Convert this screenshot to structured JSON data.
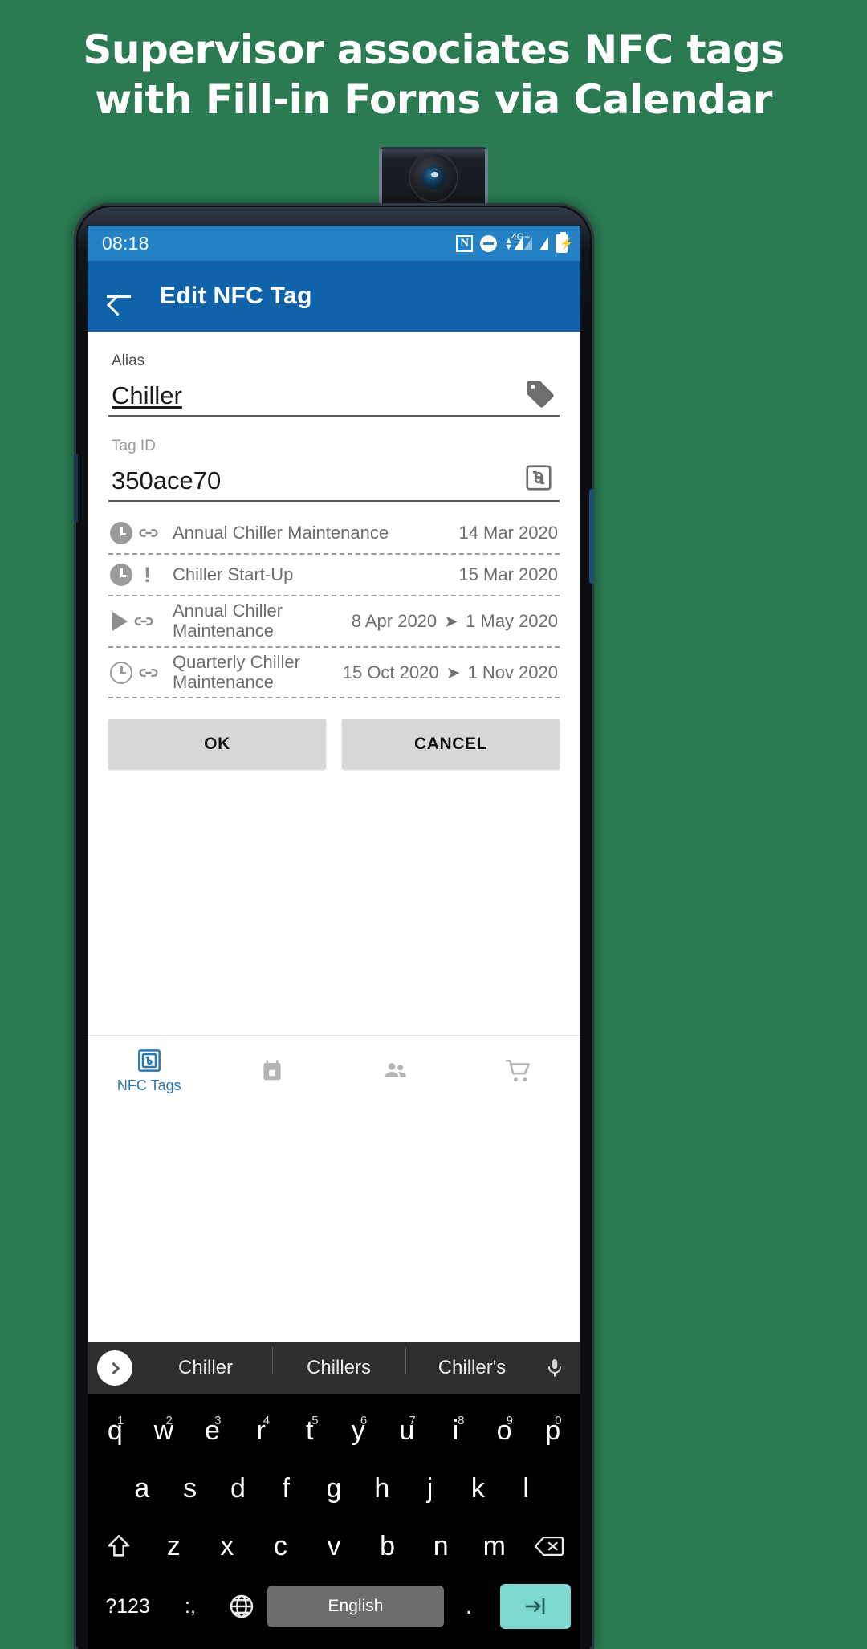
{
  "headline": {
    "line1": "Supervisor associates NFC tags",
    "line2": "with Fill-in Forms via Calendar"
  },
  "status_bar": {
    "time": "08:18",
    "icons": [
      "nfc-icon",
      "do-not-disturb-icon",
      "signal-4g-plus-icon",
      "signal-icon",
      "battery-charging-icon"
    ],
    "nfc_glyph": "N",
    "network_label": "4G+"
  },
  "app_bar": {
    "back_label": "back-arrow",
    "title": "Edit NFC Tag"
  },
  "form": {
    "alias": {
      "label": "Alias",
      "value": "Chiller",
      "icon": "tag-icon"
    },
    "tag_id": {
      "label": "Tag ID",
      "value": "350ace70",
      "icon": "nfc-square-icon"
    }
  },
  "events": [
    {
      "icons": [
        "clock-filled-icon",
        "link-icon"
      ],
      "title": "Annual Chiller Maintenance",
      "date_start": "14 Mar 2020",
      "date_end": "",
      "separator": ""
    },
    {
      "icons": [
        "clock-filled-icon",
        "exclamation-icon"
      ],
      "title": "Chiller Start-Up",
      "date_start": "15 Mar 2020",
      "date_end": "",
      "separator": ""
    },
    {
      "icons": [
        "play-triangle-icon",
        "link-icon"
      ],
      "title": "Annual Chiller Maintenance",
      "date_start": "8 Apr 2020",
      "date_end": "1 May 2020",
      "separator": "➤"
    },
    {
      "icons": [
        "clock-outline-icon",
        "link-icon"
      ],
      "title": "Quarterly Chiller Maintenance",
      "date_start": "15 Oct 2020",
      "date_end": "1 Nov 2020",
      "separator": "➤"
    }
  ],
  "actions": {
    "ok": "OK",
    "cancel": "CANCEL"
  },
  "bottom_nav": {
    "items": [
      {
        "label": "NFC Tags",
        "icon": "nfc-square-icon",
        "active": true
      },
      {
        "label": "",
        "icon": "calendar-icon",
        "active": false
      },
      {
        "label": "",
        "icon": "people-icon",
        "active": false
      },
      {
        "label": "",
        "icon": "cart-icon",
        "active": false
      }
    ]
  },
  "keyboard": {
    "suggestions": [
      "Chiller",
      "Chillers",
      "Chiller's"
    ],
    "expand_icon": "chevron-right-icon",
    "mic_icon": "microphone-icon",
    "row1": [
      {
        "key": "q",
        "num": "1"
      },
      {
        "key": "w",
        "num": "2"
      },
      {
        "key": "e",
        "num": "3"
      },
      {
        "key": "r",
        "num": "4"
      },
      {
        "key": "t",
        "num": "5"
      },
      {
        "key": "y",
        "num": "6"
      },
      {
        "key": "u",
        "num": "7"
      },
      {
        "key": "i",
        "num": "8"
      },
      {
        "key": "o",
        "num": "9"
      },
      {
        "key": "p",
        "num": "0"
      }
    ],
    "row2": [
      "a",
      "s",
      "d",
      "f",
      "g",
      "h",
      "j",
      "k",
      "l"
    ],
    "row3": [
      "z",
      "x",
      "c",
      "v",
      "b",
      "n",
      "m"
    ],
    "shift_icon": "shift-icon",
    "backspace_icon": "backspace-icon",
    "row4": {
      "symbols": "?123",
      "emoji": ":,",
      "globe_icon": "globe-icon",
      "space_label": "English",
      "period": ".",
      "enter_icon": "enter-tab-icon"
    }
  },
  "colors": {
    "background_green": "#2a7a52",
    "status_blue": "#2482c4",
    "appbar_blue": "#1063a8",
    "accent_blue": "#2a77b5",
    "button_grey": "#d8d8d8",
    "enter_teal": "#7fd8cf"
  }
}
